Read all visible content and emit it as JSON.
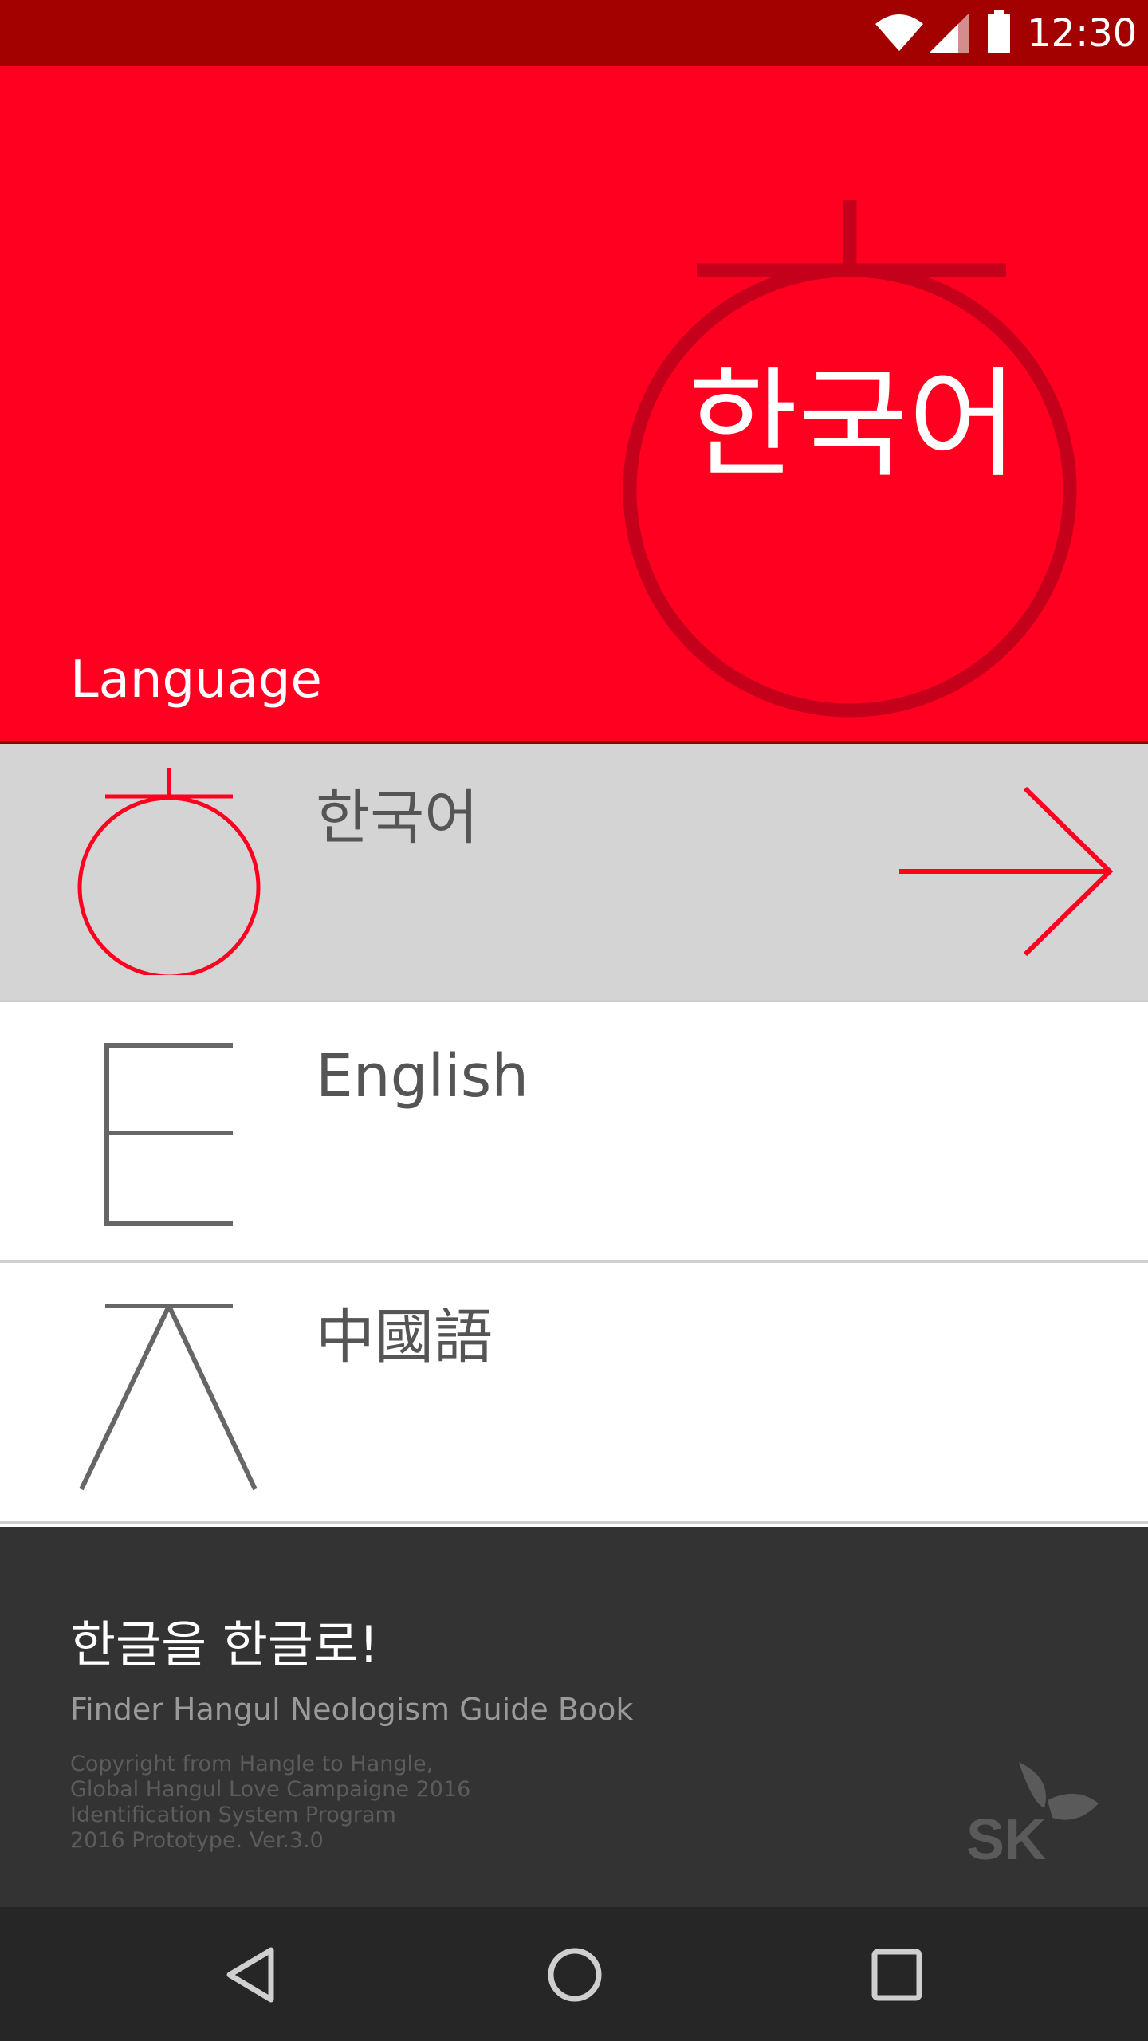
{
  "status_bar": {
    "time": "12:30",
    "icons": [
      "wifi-icon",
      "cell-signal-icon",
      "battery-icon"
    ]
  },
  "hero": {
    "emblem_label": "한국어",
    "section_title": "Language",
    "background_color": "#ff0020"
  },
  "languages": [
    {
      "label": "한국어",
      "icon": "hangul-ieung-icon",
      "selected": true
    },
    {
      "label": "English",
      "icon": "letter-e-icon",
      "selected": false
    },
    {
      "label": "中國語",
      "icon": "hangul-jieut-icon",
      "selected": false
    }
  ],
  "footer": {
    "slogan": "한글을 한글로!",
    "subtitle": "Finder Hangul Neologism Guide Book",
    "copyright_lines": [
      "Copyright from Hangle to Hangle,",
      "Global Hangul Love Campaigne 2016",
      "Identification System Program",
      "2016 Prototype. Ver.3.0"
    ],
    "logo": "SK"
  },
  "nav": {
    "buttons": [
      "back-button",
      "home-button",
      "recents-button"
    ]
  },
  "colors": {
    "accent": "#ff0020",
    "status_bar": "#a30000",
    "footer": "#333333",
    "nav_bar": "#262626",
    "selected_row": "#d4d4d4"
  }
}
